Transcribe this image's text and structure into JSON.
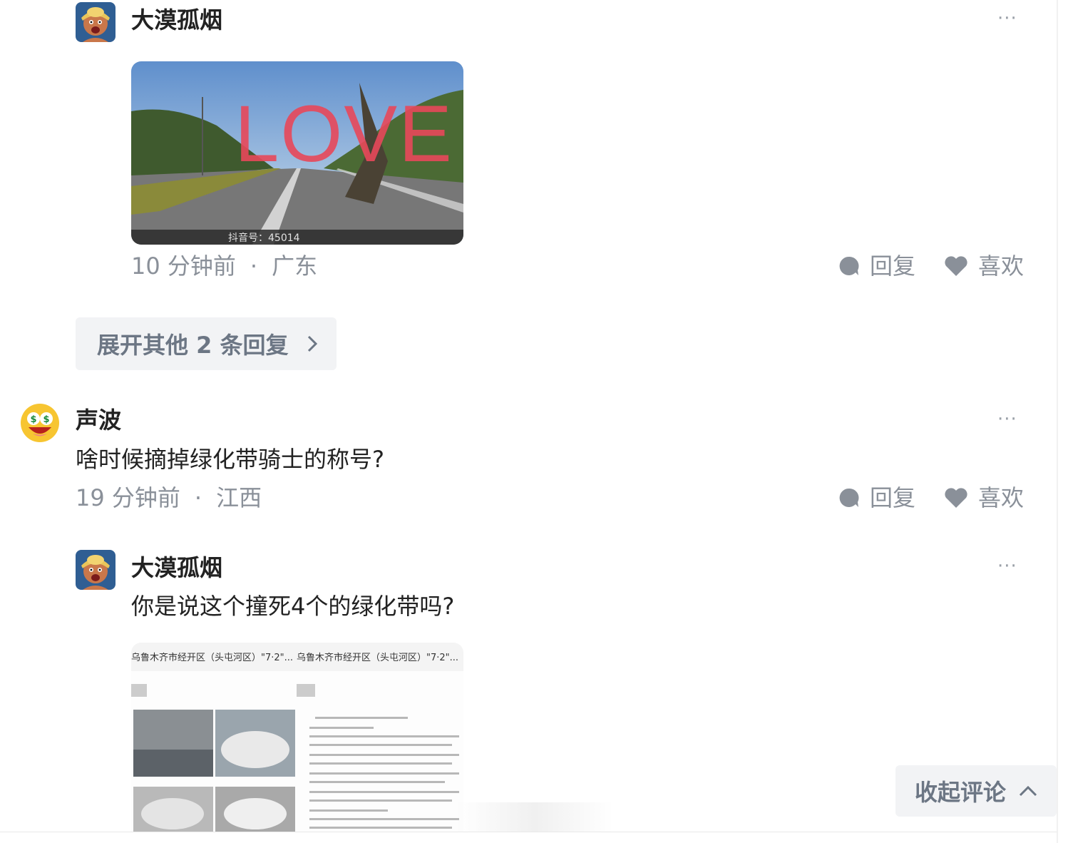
{
  "reply_1": {
    "username": "大漠孤烟",
    "avatar_icon": "cartoon-avatar-icon",
    "image_overlay_text": "LOVE",
    "image_watermark": "抖音号：45014",
    "time": "10 分钟前",
    "location": "广东",
    "reply_label": "回复",
    "like_label": "喜欢"
  },
  "expand_replies": {
    "label": "展开其他 2 条回复"
  },
  "comment_2": {
    "username": "声波",
    "avatar_icon": "money-eyes-emoji-icon",
    "text": "啥时候摘掉绿化带骑士的称号?",
    "time": "19 分钟前",
    "location": "江西",
    "reply_label": "回复",
    "like_label": "喜欢"
  },
  "reply_2": {
    "username": "大漠孤烟",
    "avatar_icon": "cartoon-avatar-icon",
    "text": "你是说这个撞死4个的绿化带吗?",
    "doc_title_left": "乌鲁木齐市经开区（头屯河区）\"7·2\"...",
    "doc_title_right": "乌鲁木齐市经开区（头屯河区）\"7·2\"..."
  },
  "more_label": "···",
  "collapse_comments": {
    "label": "收起评论"
  },
  "colors": {
    "muted": "#8a9099",
    "button_bg": "#f2f3f5",
    "button_text": "#6c7684",
    "love_text": "#e8485a"
  }
}
